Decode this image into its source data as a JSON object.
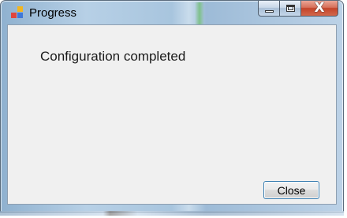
{
  "window": {
    "title": "Progress",
    "icon": "app-icon"
  },
  "caption_buttons": {
    "minimize_icon": "minimize-icon",
    "maximize_icon": "maximize-icon",
    "close_icon": "close-icon",
    "close_glyph": "X"
  },
  "dialog": {
    "message": "Configuration completed",
    "close_label": "Close"
  },
  "colors": {
    "title_bar": "#b7d0e6",
    "client_bg": "#f0f0f0",
    "close_caption": "#c3442a",
    "button_border": "#3c7fb1"
  }
}
